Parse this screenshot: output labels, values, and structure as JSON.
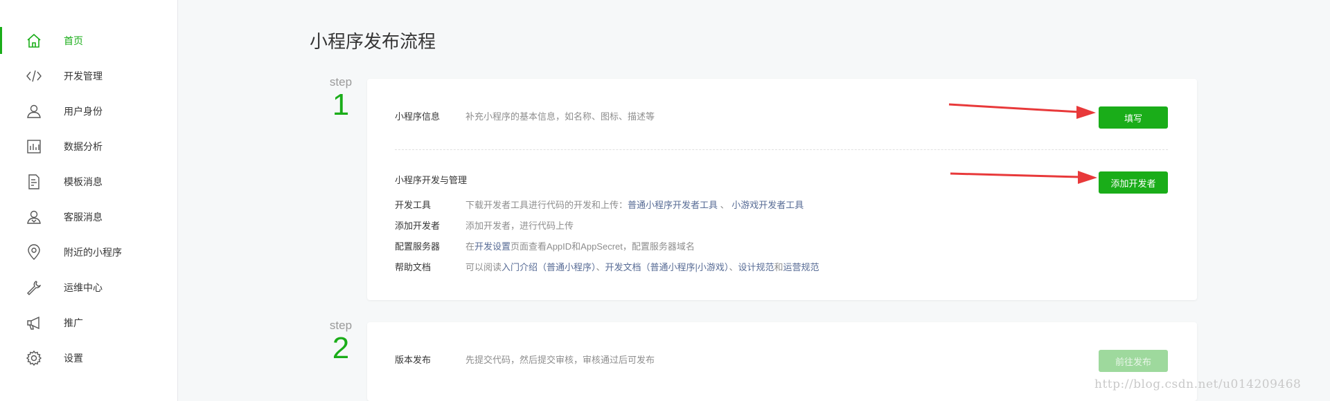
{
  "sidebar": {
    "items": [
      {
        "label": "首页",
        "icon": "home-icon",
        "active": true
      },
      {
        "label": "开发管理",
        "icon": "code-icon"
      },
      {
        "label": "用户身份",
        "icon": "user-icon"
      },
      {
        "label": "数据分析",
        "icon": "chart-icon"
      },
      {
        "label": "模板消息",
        "icon": "document-icon"
      },
      {
        "label": "客服消息",
        "icon": "customer-service-icon"
      },
      {
        "label": "附近的小程序",
        "icon": "location-pin-icon"
      },
      {
        "label": "运维中心",
        "icon": "wrench-icon"
      },
      {
        "label": "推广",
        "icon": "megaphone-icon"
      },
      {
        "label": "设置",
        "icon": "gear-icon"
      }
    ]
  },
  "main": {
    "title": "小程序发布流程",
    "step1": {
      "tag": "step",
      "num": "1",
      "info_label": "小程序信息",
      "info_desc": "补充小程序的基本信息，如名称、图标、描述等",
      "fill_button": "填写",
      "dev_heading": "小程序开发与管理",
      "add_dev_button": "添加开发者",
      "rows": [
        {
          "label": "开发工具",
          "desc": "下载开发者工具进行代码的开发和上传：",
          "link1": "普通小程序开发者工具",
          "sep": " 、 ",
          "link2": "小游戏开发者工具"
        },
        {
          "label": "添加开发者",
          "desc": "添加开发者，进行代码上传"
        },
        {
          "label": "配置服务器",
          "pre": "在",
          "link1": "开发设置",
          "post": "页面查看AppID和AppSecret，配置服务器域名"
        },
        {
          "label": "帮助文档",
          "pre": "可以阅读",
          "link1": "入门介绍（普通小程序）",
          "mid": "、",
          "link2": "开发文档（普通小程序|小游戏）",
          "mid2": "、",
          "link3": "设计规范",
          "and": "和",
          "link4": "运营规范"
        }
      ]
    },
    "step2": {
      "tag": "step",
      "num": "2",
      "label": "版本发布",
      "desc": "先提交代码，然后提交审核，审核通过后可发布",
      "button": "前往发布"
    }
  },
  "colors": {
    "accent": "#1aad19",
    "link": "#576b95",
    "arrow": "#e8393a"
  },
  "watermark": "http://blog.csdn.net/u014209468"
}
